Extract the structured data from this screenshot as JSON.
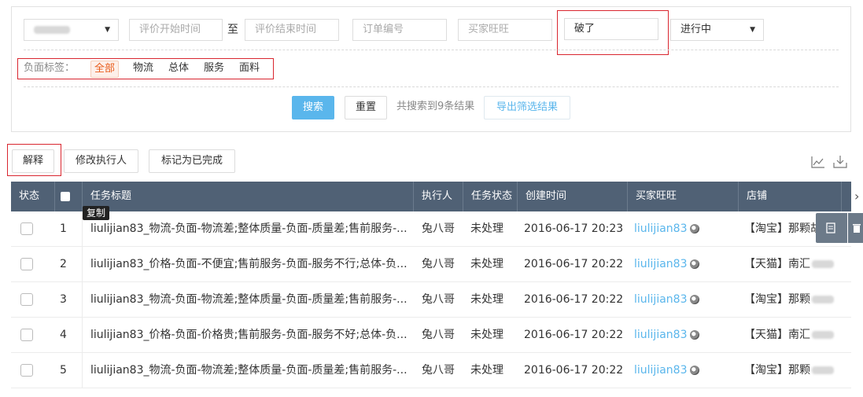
{
  "filters": {
    "shop_select_selected": "",
    "eval_start_placeholder": "评价开始时间",
    "to_label": "至",
    "eval_end_placeholder": "评价结束时间",
    "order_no_placeholder": "订单编号",
    "buyer_placeholder": "买家旺旺",
    "keyword_value": "破了",
    "status_selected": "进行中",
    "neg_tag_label": "负面标签：",
    "neg_tags": [
      "全部",
      "物流",
      "总体",
      "服务",
      "面料"
    ],
    "search_label": "搜索",
    "reset_label": "重置",
    "result_text": "共搜索到9条结果",
    "export_label": "导出筛选结果"
  },
  "toolbar": {
    "explain_label": "解释",
    "modify_assignee_label": "修改执行人",
    "mark_done_label": "标记为已完成"
  },
  "table": {
    "headers": [
      "状态",
      "",
      "任务标题",
      "执行人",
      "任务状态",
      "创建时间",
      "买家旺旺",
      "店铺"
    ],
    "copy_tooltip": "复制",
    "rows": [
      {
        "no": "1",
        "title": "liulijian83_物流-负面-物流差;整体质量-负面-质量差;售前服务-...",
        "assignee": "兔八哥",
        "status": "未处理",
        "created": "2016-06-17 20:23",
        "buyer": "liulijian83",
        "shop": "【淘宝】那颗胡巴"
      },
      {
        "no": "2",
        "title": "liulijian83_价格-负面-不便宜;售前服务-负面-服务不行;总体-负...",
        "assignee": "兔八哥",
        "status": "未处理",
        "created": "2016-06-17 20:22",
        "buyer": "liulijian83",
        "shop": "【天猫】南汇"
      },
      {
        "no": "3",
        "title": "liulijian83_物流-负面-物流差;整体质量-负面-质量差;售前服务-...",
        "assignee": "兔八哥",
        "status": "未处理",
        "created": "2016-06-17 20:22",
        "buyer": "liulijian83",
        "shop": "【淘宝】那颗"
      },
      {
        "no": "4",
        "title": "liulijian83_价格-负面-价格贵;售前服务-负面-服务不好;总体-负...",
        "assignee": "兔八哥",
        "status": "未处理",
        "created": "2016-06-17 20:22",
        "buyer": "liulijian83",
        "shop": "【天猫】南汇"
      },
      {
        "no": "5",
        "title": "liulijian83_物流-负面-物流差;整体质量-负面-质量差;售前服务-...",
        "assignee": "兔八哥",
        "status": "未处理",
        "created": "2016-06-17 20:22",
        "buyer": "liulijian83",
        "shop": "【淘宝】那颗"
      }
    ]
  },
  "colors": {
    "accent": "#5ab6ec",
    "header_bg": "#506175",
    "active_tag": "#e95c1a",
    "highlight_box": "#d9262f"
  }
}
